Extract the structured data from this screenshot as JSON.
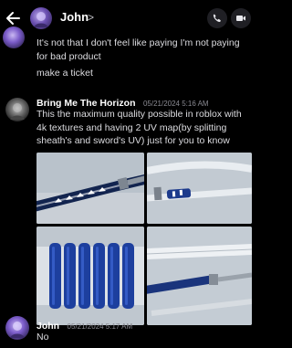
{
  "header": {
    "back_icon": "arrow-left-icon",
    "contact_name": "John",
    "chevron": ">",
    "call_icon": "phone-icon",
    "video_icon": "video-camera-icon"
  },
  "messages": [
    {
      "text_lines": [
        "It's not that I don't feel like paying I'm not paying",
        "for bad product"
      ]
    },
    {
      "text": "make a ticket"
    },
    {
      "username": "Bring Me The Horizon",
      "timestamp": "05/21/2024 5:16 AM",
      "text_lines": [
        "This the maximum quality possible in roblox with",
        "4k textures and having 2 UV map(by splitting",
        "sheath's and sword's UV) just for you to know"
      ],
      "attachments": [
        "image-1",
        "image-2",
        "image-3",
        "image-4"
      ]
    },
    {
      "username": "John",
      "timestamp": "05/21/2024 5:17 AM",
      "text": "No"
    }
  ],
  "colors": {
    "background": "#000000",
    "text": "#dcdce0",
    "username": "#ffffff",
    "timestamp": "#8a8a92",
    "sword_blue": "#1f3f9a"
  }
}
